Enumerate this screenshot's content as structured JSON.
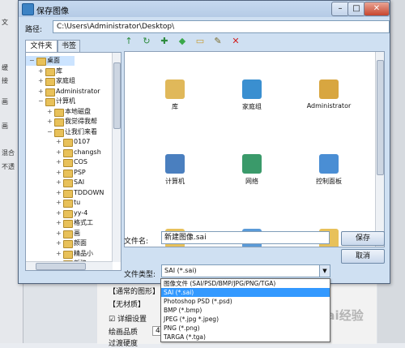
{
  "dialog": {
    "title": "保存图像",
    "window_buttons": {
      "minimize": "–",
      "maximize": "□",
      "close": "✕"
    }
  },
  "path": {
    "label": "路径:",
    "value": "C:\\Users\\Administrator\\Desktop\\"
  },
  "tabs": [
    {
      "label": "文件夹"
    },
    {
      "label": "书签"
    }
  ],
  "tree": [
    {
      "label": "桌面",
      "expander": "−",
      "icon": "desktop-icon"
    },
    {
      "label": "库",
      "expander": "+",
      "icon": "library-icon"
    },
    {
      "label": "家庭组",
      "expander": "+",
      "icon": "homegroup-icon"
    },
    {
      "label": "Administrator",
      "expander": "+",
      "icon": "user-folder-icon"
    },
    {
      "label": "计算机",
      "expander": "−",
      "icon": "computer-icon"
    },
    {
      "label": "本地磁盘",
      "expander": "+",
      "icon": "drive-icon"
    },
    {
      "label": "我觉得我帮",
      "expander": "+",
      "icon": "drive-icon"
    },
    {
      "label": "让我们来看",
      "expander": "−",
      "icon": "drive-icon"
    },
    {
      "label": "0107",
      "expander": "+",
      "icon": "folder-icon"
    },
    {
      "label": "changsh",
      "expander": "+",
      "icon": "folder-icon"
    },
    {
      "label": "COS",
      "expander": "+",
      "icon": "folder-icon"
    },
    {
      "label": "PSP",
      "expander": "+",
      "icon": "folder-icon"
    },
    {
      "label": "SAI",
      "expander": "+",
      "icon": "folder-icon"
    },
    {
      "label": "TDDOWN",
      "expander": "+",
      "icon": "folder-icon"
    },
    {
      "label": "tu",
      "expander": "+",
      "icon": "folder-icon"
    },
    {
      "label": "yy-4",
      "expander": "+",
      "icon": "folder-icon"
    },
    {
      "label": "格式工",
      "expander": "+",
      "icon": "folder-icon"
    },
    {
      "label": "画",
      "expander": "+",
      "icon": "folder-icon"
    },
    {
      "label": "颜面",
      "expander": "+",
      "icon": "folder-icon"
    },
    {
      "label": "精品小",
      "expander": "+",
      "icon": "folder-icon"
    },
    {
      "label": "新建",
      "expander": "+",
      "icon": "folder-icon"
    }
  ],
  "toolbar": [
    {
      "name": "up-folder-icon",
      "glyph": "↑",
      "color": "#2e8b3e"
    },
    {
      "name": "refresh-icon",
      "glyph": "↻",
      "color": "#2e8b3e"
    },
    {
      "name": "bookmark-icon",
      "glyph": "✚",
      "color": "#2e8b3e"
    },
    {
      "name": "tag-icon",
      "glyph": "◆",
      "color": "#3aa84a"
    },
    {
      "name": "new-folder-icon",
      "glyph": "▭",
      "color": "#c79a2f"
    },
    {
      "name": "rename-icon",
      "glyph": "✎",
      "color": "#7a6a2a"
    },
    {
      "name": "delete-icon",
      "glyph": "✕",
      "color": "#d02020"
    }
  ],
  "files": [
    {
      "label": "库",
      "icon": "library-icon"
    },
    {
      "label": "家庭组",
      "icon": "homegroup-icon"
    },
    {
      "label": "Administrator",
      "icon": "user-folder-icon"
    },
    {
      "label": "计算机",
      "icon": "computer-icon"
    },
    {
      "label": "网络",
      "icon": "network-icon"
    },
    {
      "label": "控制面板",
      "icon": "control-panel-icon"
    },
    {
      "label": "",
      "icon": "folder-icon"
    },
    {
      "label": "",
      "icon": "monitor-icon"
    },
    {
      "label": "",
      "icon": "folder-icon"
    }
  ],
  "filename": {
    "label": "文件名:",
    "value": "新建图像.sai"
  },
  "filetype": {
    "label": "文件类型:",
    "value": "SAI (*.sai)",
    "arrow": "▼"
  },
  "buttons": {
    "save": "保存",
    "cancel": "取消"
  },
  "dropdown_options": [
    "图像文件 (SAI/PSD/BMP/JPG/PNG/TGA)",
    "SAI (*.sai)",
    "Photoshop PSD (*.psd)",
    "BMP (*.bmp)",
    "JPEG (*.jpg *.jpeg)",
    "PNG (*.png)",
    "TARGA (*.tga)"
  ],
  "dropdown_selected_index": 1,
  "background_app": {
    "menu_item": "文",
    "side_labels": [
      "缓",
      "接",
      "画",
      "画",
      "混合",
      "不透"
    ],
    "panel_labels": [
      "【通常的图形】",
      "【无材质】",
      "详细设置",
      "绘画品质",
      "过渡硬度"
    ],
    "quality_value": "4"
  },
  "watermark": {
    "text": "Bai经验"
  }
}
